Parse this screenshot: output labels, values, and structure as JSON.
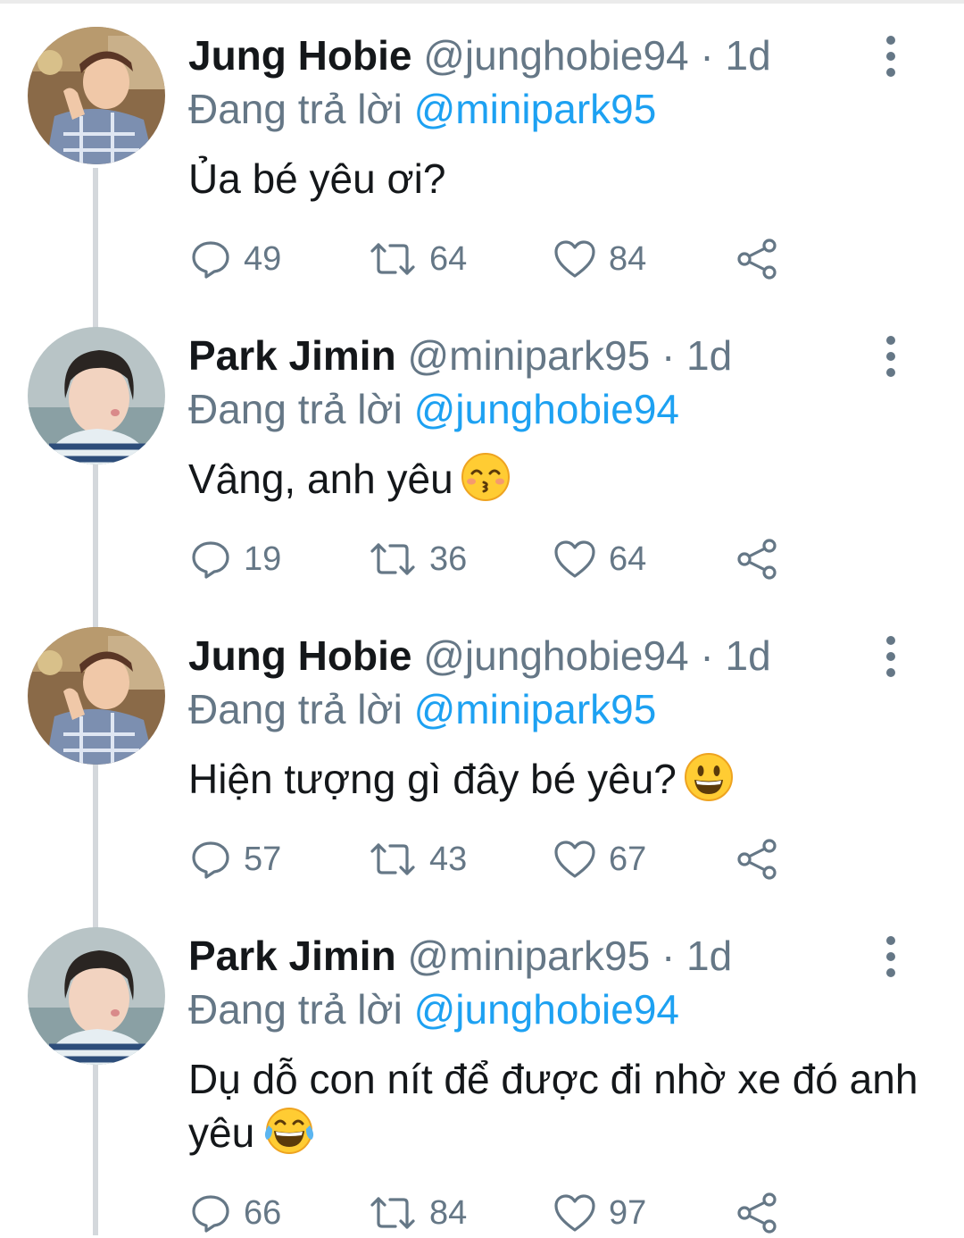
{
  "reply_prefix": "Đang trả lời",
  "tweets": [
    {
      "name": "Jung Hobie",
      "handle": "@junghobie94",
      "time": "· 1d",
      "reply_to": "@minipark95",
      "text": "Ủa bé yêu ơi?",
      "emoji": null,
      "avatar": "avatar-jung-hobie",
      "replies": "49",
      "retweets": "64",
      "likes": "84"
    },
    {
      "name": "Park Jimin",
      "handle": "@minipark95",
      "time": "· 1d",
      "reply_to": "@junghobie94",
      "text": "Vâng, anh yêu",
      "emoji": "kissing-face-with-smiling-eyes",
      "avatar": "avatar-park-jimin",
      "replies": "19",
      "retweets": "36",
      "likes": "64"
    },
    {
      "name": "Jung Hobie",
      "handle": "@junghobie94",
      "time": "· 1d",
      "reply_to": "@minipark95",
      "text": "Hiện tượng gì đây bé yêu?",
      "emoji": "grinning-face",
      "avatar": "avatar-jung-hobie",
      "replies": "57",
      "retweets": "43",
      "likes": "67"
    },
    {
      "name": "Park Jimin",
      "handle": "@minipark95",
      "time": "· 1d",
      "reply_to": "@junghobie94",
      "text": "Dụ dỗ con nít để được đi nhờ xe đó anh yêu",
      "emoji": "face-with-tears-of-joy",
      "avatar": "avatar-park-jimin",
      "replies": "66",
      "retweets": "84",
      "likes": "97"
    }
  ],
  "icons": {
    "reply": "speech-bubble-icon",
    "retweet": "retweet-icon",
    "like": "heart-icon",
    "share": "share-icon",
    "more": "vertical-ellipsis-icon"
  },
  "colors": {
    "text": "#14171a",
    "secondary": "#657786",
    "mention": "#1da1f2",
    "thread_line": "#d4d8dc",
    "background": "#ffffff"
  }
}
